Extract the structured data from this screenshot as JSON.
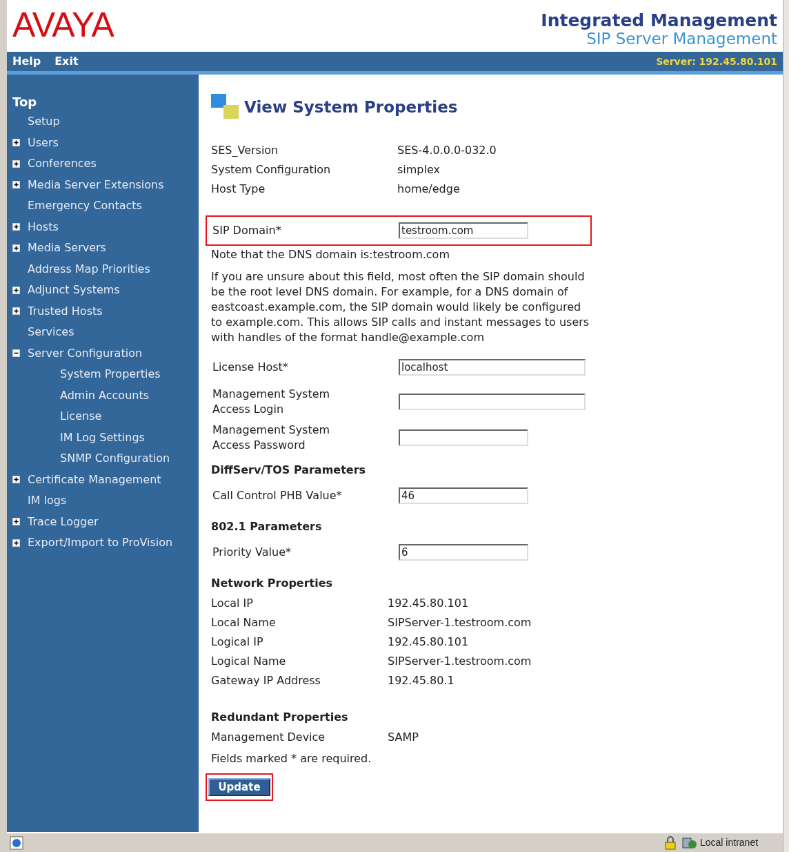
{
  "header": {
    "logo": "AVAYA",
    "title": "Integrated Management",
    "subtitle": "SIP Server Management"
  },
  "menu_bar": {
    "items": [
      "Help",
      "Exit"
    ],
    "server": "Server: 192.45.80.101"
  },
  "sidebar": {
    "heading": "Top",
    "items": [
      {
        "label": "Setup",
        "kind": "link"
      },
      {
        "label": "Users",
        "kind": "node",
        "expanded": false
      },
      {
        "label": "Conferences",
        "kind": "node",
        "expanded": false
      },
      {
        "label": "Media Server Extensions",
        "kind": "node",
        "expanded": false
      },
      {
        "label": "Emergency Contacts",
        "kind": "link"
      },
      {
        "label": "Hosts",
        "kind": "node",
        "expanded": false
      },
      {
        "label": "Media Servers",
        "kind": "node",
        "expanded": false
      },
      {
        "label": "Address Map Priorities",
        "kind": "link"
      },
      {
        "label": "Adjunct Systems",
        "kind": "node",
        "expanded": false
      },
      {
        "label": "Trusted Hosts",
        "kind": "node",
        "expanded": false
      },
      {
        "label": "Services",
        "kind": "link"
      },
      {
        "label": "Server Configuration",
        "kind": "node",
        "expanded": true,
        "children": [
          {
            "label": "System Properties"
          },
          {
            "label": "Admin Accounts"
          },
          {
            "label": "License"
          },
          {
            "label": "IM Log Settings"
          },
          {
            "label": "SNMP Configuration"
          }
        ]
      },
      {
        "label": "Certificate Management",
        "kind": "node",
        "expanded": false
      },
      {
        "label": "IM logs",
        "kind": "link"
      },
      {
        "label": "Trace Logger",
        "kind": "node",
        "expanded": false
      },
      {
        "label": "Export/Import to ProVision",
        "kind": "node",
        "expanded": false
      }
    ]
  },
  "page_title": "View System Properties",
  "blocks": [
    {
      "kind": "info",
      "rows": [
        {
          "label": "SES_Version",
          "value": "SES-4.0.0.0-032.0"
        },
        {
          "label": "System Configuration",
          "value": "simplex"
        },
        {
          "label": "Host Type",
          "value": "home/edge"
        }
      ]
    },
    {
      "kind": "field",
      "label": "SIP Domain*",
      "value": "testroom.com",
      "highlighted": true
    },
    {
      "kind": "text",
      "text": "Note that the DNS domain is:testroom.com"
    },
    {
      "kind": "text",
      "text": "If you are unsure about this field, most often the SIP domain should be the root level DNS domain. For example, for a DNS domain of eastcoast.example.com, the SIP domain would likely be configured to example.com. This allows SIP calls and instant messages to users with handles of the format handle@example.com"
    },
    {
      "kind": "wide_field",
      "label": "License Host*",
      "value": "localhost",
      "highlighted": false
    },
    {
      "kind": "wide_field",
      "label": "Management System Access Login",
      "highlighted": false
    },
    {
      "kind": "field",
      "label": "Management System Access Password",
      "highlighted": false
    },
    {
      "kind": "heading",
      "text": "DiffServ/TOS Parameters"
    },
    {
      "kind": "field",
      "label": "Call Control PHB Value*",
      "value": "46",
      "highlighted": false
    },
    {
      "kind": "heading",
      "text": "802.1 Parameters"
    },
    {
      "kind": "field",
      "label": "Priority Value*",
      "value": "6",
      "highlighted": false
    },
    {
      "kind": "heading",
      "text": "Network Properties"
    },
    {
      "kind": "info2",
      "rows": [
        {
          "label": "Local IP",
          "value": "192.45.80.101"
        },
        {
          "label": "Local Name",
          "value": "SIPServer-1.testroom.com"
        },
        {
          "label": "Logical IP",
          "value": "192.45.80.101"
        },
        {
          "label": "Logical Name",
          "value": "SIPServer-1.testroom.com"
        },
        {
          "label": "Gateway IP Address",
          "value": "192.45.80.1"
        }
      ]
    },
    {
      "kind": "heading",
      "text": "Redundant Properties"
    },
    {
      "kind": "info3",
      "rows": [
        {
          "label": "Management Device",
          "value": "SAMP"
        }
      ]
    },
    {
      "kind": "text",
      "text": "Fields marked * are required."
    }
  ],
  "update_button": {
    "label": "Update",
    "highlighted": true
  },
  "status_bar": {
    "zone": "Local intranet"
  }
}
